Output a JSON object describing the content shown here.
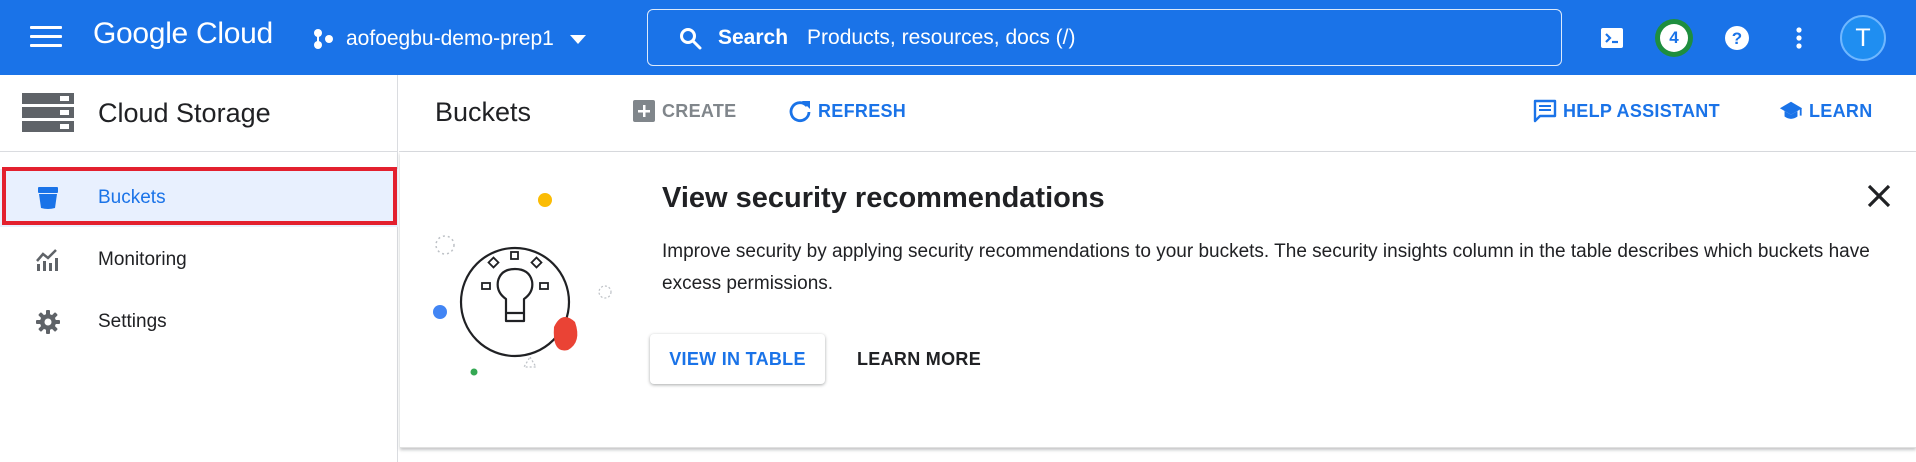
{
  "topbar": {
    "logo": "Google Cloud",
    "project": "aofoegbu-demo-prep1",
    "search_label": "Search",
    "search_placeholder": "Products, resources, docs (/)",
    "notifications_count": "4",
    "avatar_letter": "T",
    "color": "#1a73e8"
  },
  "sidebar": {
    "title": "Cloud Storage",
    "items": [
      {
        "label": "Buckets",
        "icon": "bucket-icon",
        "active": true
      },
      {
        "label": "Monitoring",
        "icon": "monitoring-icon",
        "active": false
      },
      {
        "label": "Settings",
        "icon": "gear-icon",
        "active": false
      }
    ]
  },
  "header": {
    "title": "Buckets",
    "create_label": "CREATE",
    "refresh_label": "REFRESH",
    "help_label": "HELP ASSISTANT",
    "learn_label": "LEARN"
  },
  "card": {
    "title": "View security recommendations",
    "description": "Improve security by applying security recommendations to your buckets. The security insights column in the table describes which buckets have excess permissions.",
    "primary_button": "VIEW IN TABLE",
    "secondary_button": "LEARN MORE"
  }
}
